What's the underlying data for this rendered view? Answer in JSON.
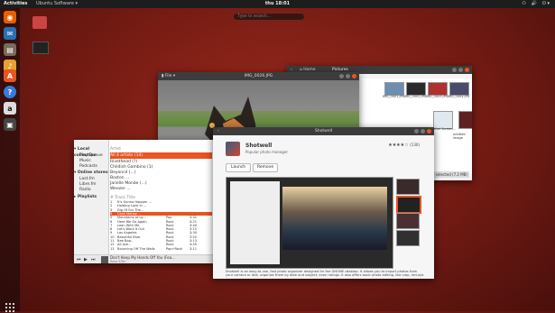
{
  "topbar": {
    "activities": "Activities",
    "app_menu": "Ubuntu Software ▾",
    "clock": "thu 18:01",
    "tray": [
      "⚇",
      "🔊",
      "⏻ ▾"
    ]
  },
  "search": {
    "placeholder": "Type to search..."
  },
  "desktop": {
    "icons": [
      {
        "label": "trash"
      },
      {
        "label": "disk"
      }
    ]
  },
  "dock": {
    "apps": [
      {
        "name": "firefox-icon",
        "glyph": "◉",
        "color": "#e66000"
      },
      {
        "name": "thunderbird-icon",
        "glyph": "✉",
        "color": "#2a6fb4"
      },
      {
        "name": "files-icon",
        "glyph": "▤",
        "color": "#7a6a5a"
      },
      {
        "name": "rhythmbox-icon",
        "glyph": "♪",
        "color": "#e8a030"
      },
      {
        "name": "software-icon",
        "glyph": "A",
        "color": "#e95420"
      },
      {
        "name": "help-icon",
        "glyph": "?",
        "color": "#3a7bd5"
      },
      {
        "name": "amazon-icon",
        "glyph": "a",
        "color": "#ddd"
      },
      {
        "name": "shotwell-icon",
        "glyph": "▣",
        "color": "#444"
      }
    ]
  },
  "files": {
    "location": "Pictures",
    "back": "‹",
    "home": "⌂ Home",
    "items": [
      {
        "label": "IMG_0001.JPG",
        "color": "#6a8fb0"
      },
      {
        "label": "IMG_0002.JPG",
        "color": "#2a2a2a"
      },
      {
        "label": "IMG_0003.JPG",
        "color": "#b03030"
      },
      {
        "label": "IMG_0004.JPG",
        "color": "#4a4a6a"
      },
      {
        "label": "Safari Screen...",
        "color": "#e0e8f0"
      },
      {
        "label": "untitled image",
        "color": "#602020"
      },
      {
        "label": "Screenshot from...",
        "color": "#5070a0"
      }
    ],
    "status": "selected (7.2 MB)"
  },
  "viewer": {
    "title": "IMG_0026.JPG",
    "toolbar": "▮ File ▾"
  },
  "music": {
    "sidebar_header_lib": "▾ Local collection",
    "library": [
      "Play Queue",
      "Music",
      "Podcasts"
    ],
    "sidebar_header_online": "▾ Online stores",
    "online": [
      "Last.fm",
      "Libre.fm",
      "Radio"
    ],
    "sidebar_header_pl": "▸ Playlists",
    "artist_header": "Artist",
    "artist_list": [
      "All 4 artists (14)",
      "Rivethead (?)",
      "Childish Gambino (1)",
      "Beyoncé (...)",
      "Boston ...",
      "Janelle Monáe (...)",
      "Weezer ..."
    ],
    "track_header": "# Track  Title",
    "tracks": [
      {
        "n": "1",
        "title": "It's Gonna Happen ...",
        "genre": "",
        "time": ""
      },
      {
        "n": "2",
        "title": "Holding Love in ...",
        "genre": "",
        "time": ""
      },
      {
        "n": "3",
        "title": "Dig Of For The...",
        "genre": "",
        "time": ""
      },
      {
        "n": "4",
        "title": "Cash Money ...",
        "genre": "",
        "time": ""
      },
      {
        "n": "5",
        "title": "Mountains of Lo...",
        "genre": "Pop",
        "time": "3:31"
      },
      {
        "n": "6",
        "title": "Here We Go Again",
        "genre": "Rock",
        "time": "4:21"
      },
      {
        "n": "7",
        "title": "Lean With Me",
        "genre": "Rock",
        "time": "3:40"
      },
      {
        "n": "8",
        "title": "Let's Work It Out",
        "genre": "Rock",
        "time": "3:15"
      },
      {
        "n": "9",
        "title": "Los Angeles",
        "genre": "Rock",
        "time": "3:30"
      },
      {
        "n": "10",
        "title": "Beautiful Blue",
        "genre": "Rock",
        "time": "3:52"
      },
      {
        "n": "11",
        "title": "Bee Bop..",
        "genre": "Rock",
        "time": "3:13"
      },
      {
        "n": "12",
        "title": "All Jive...",
        "genre": "Rock",
        "time": "4:55"
      },
      {
        "n": "13",
        "title": "Bouncing Off The Walls",
        "genre": "Pop+Rock",
        "time": "3:11"
      }
    ],
    "now_playing": "Don't Keep My Hands Off You (Fea...",
    "now_artist": "Rose Eller",
    "controls": [
      "⏮",
      "▶",
      "⏭"
    ]
  },
  "software": {
    "title": "Shotwell",
    "header": "Shotwell",
    "back": "‹",
    "app_name": "Shotwell",
    "app_summary": "Popular photo manager",
    "stars": "★★★★☆",
    "rating_count": "(130)",
    "launch": "Launch",
    "remove": "Remove",
    "description": "Shotwell is an easy-to-use, fast photo organizer designed for the GNOME desktop. It allows you to import photos from your camera or disk, organize them by date and subject, even ratings. It also offers basic photo editing, like crop, red-eye ..."
  }
}
